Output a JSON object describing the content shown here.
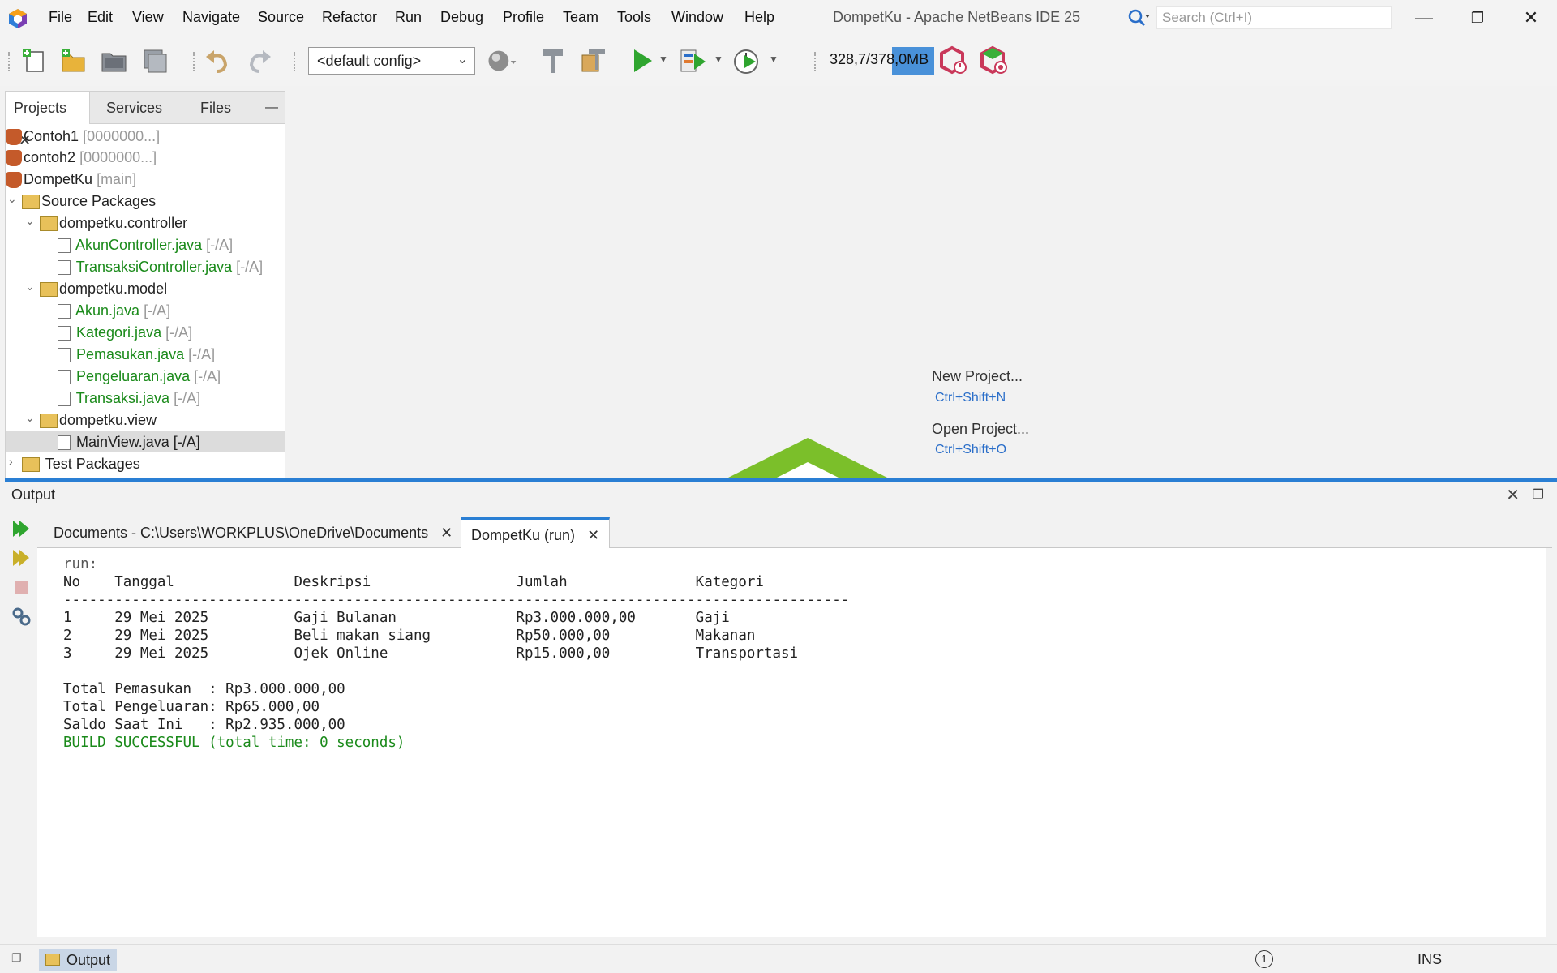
{
  "menu": [
    "File",
    "Edit",
    "View",
    "Navigate",
    "Source",
    "Refactor",
    "Run",
    "Debug",
    "Profile",
    "Team",
    "Tools",
    "Window",
    "Help"
  ],
  "window_title": "DompetKu - Apache NetBeans IDE 25",
  "search": {
    "placeholder": "Search (Ctrl+I)"
  },
  "toolbar": {
    "config": "<default config>",
    "memory": "328,7/378,0MB",
    "memory_used_fraction": 0.87
  },
  "panel_tabs": [
    "Projects",
    "Services",
    "Files"
  ],
  "tree": {
    "projects": [
      {
        "name": "Contoh1",
        "branch": "[0000000...]"
      },
      {
        "name": "contoh2",
        "branch": "[0000000...]"
      },
      {
        "name": "DompetKu",
        "branch": "[main]"
      }
    ],
    "source_packages": "Source Packages",
    "packages": [
      {
        "name": "dompetku.controller",
        "files": [
          {
            "name": "AkunController.java",
            "status": "[-/A]"
          },
          {
            "name": "TransaksiController.java",
            "status": "[-/A]"
          }
        ]
      },
      {
        "name": "dompetku.model",
        "files": [
          {
            "name": "Akun.java",
            "status": "[-/A]"
          },
          {
            "name": "Kategori.java",
            "status": "[-/A]"
          },
          {
            "name": "Pemasukan.java",
            "status": "[-/A]"
          },
          {
            "name": "Pengeluaran.java",
            "status": "[-/A]"
          },
          {
            "name": "Transaksi.java",
            "status": "[-/A]"
          }
        ]
      },
      {
        "name": "dompetku.view",
        "files": [
          {
            "name": "MainView.java",
            "status": "[-/A]"
          }
        ]
      }
    ],
    "test_packages": "Test Packages"
  },
  "welcome": {
    "new_project": "New Project...",
    "new_project_sc": "Ctrl+Shift+N",
    "open_project": "Open Project...",
    "open_project_sc": "Ctrl+Shift+O"
  },
  "output": {
    "title": "Output",
    "tabs": [
      "Documents - C:\\Users\\WORKPLUS\\OneDrive\\Documents",
      "DompetKu (run)"
    ],
    "lines": [
      "run:",
      "No    Tanggal              Deskripsi                 Jumlah               Kategori",
      "--------------------------------------------------------------------------------------------",
      "1     29 Mei 2025          Gaji Bulanan              Rp3.000.000,00       Gaji",
      "2     29 Mei 2025          Beli makan siang          Rp50.000,00          Makanan",
      "3     29 Mei 2025          Ojek Online               Rp15.000,00          Transportasi",
      "",
      "Total Pemasukan  : Rp3.000.000,00",
      "Total Pengeluaran: Rp65.000,00",
      "Saldo Saat Ini   : Rp2.935.000,00",
      "BUILD SUCCESSFUL (total time: 0 seconds)"
    ]
  },
  "status": {
    "output_label": "Output",
    "notifications": "1",
    "mode": "INS"
  }
}
